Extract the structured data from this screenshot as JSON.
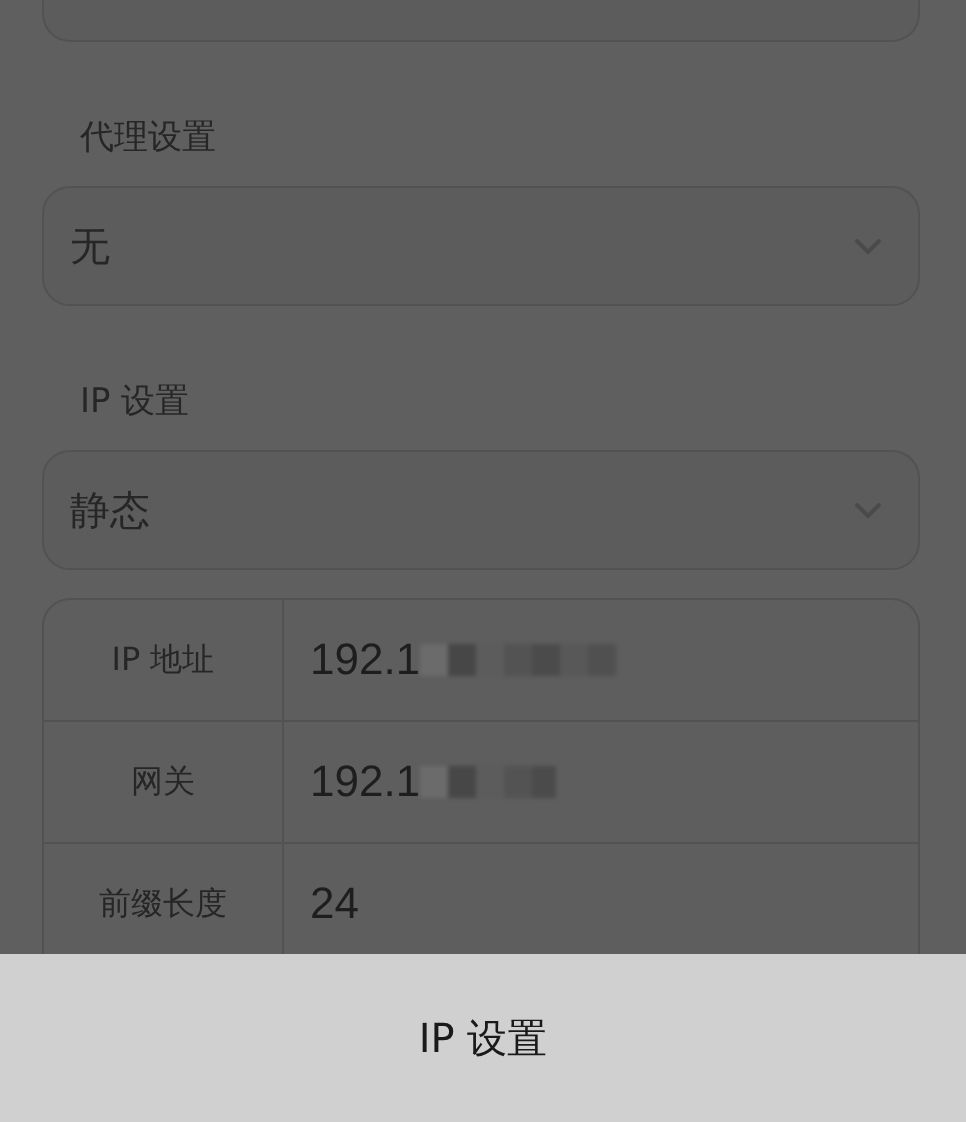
{
  "sections": [
    {
      "label": "代理设置",
      "value": "无"
    },
    {
      "label": "IP 设置",
      "value": "静态"
    }
  ],
  "ip_table": [
    {
      "label": "IP 地址",
      "value": "192.1",
      "redacted": true
    },
    {
      "label": "网关",
      "value": "192.1",
      "redacted": true
    },
    {
      "label": "前缀长度",
      "value": "24",
      "redacted": false
    }
  ],
  "action_sheet": {
    "option": "IP 设置"
  }
}
